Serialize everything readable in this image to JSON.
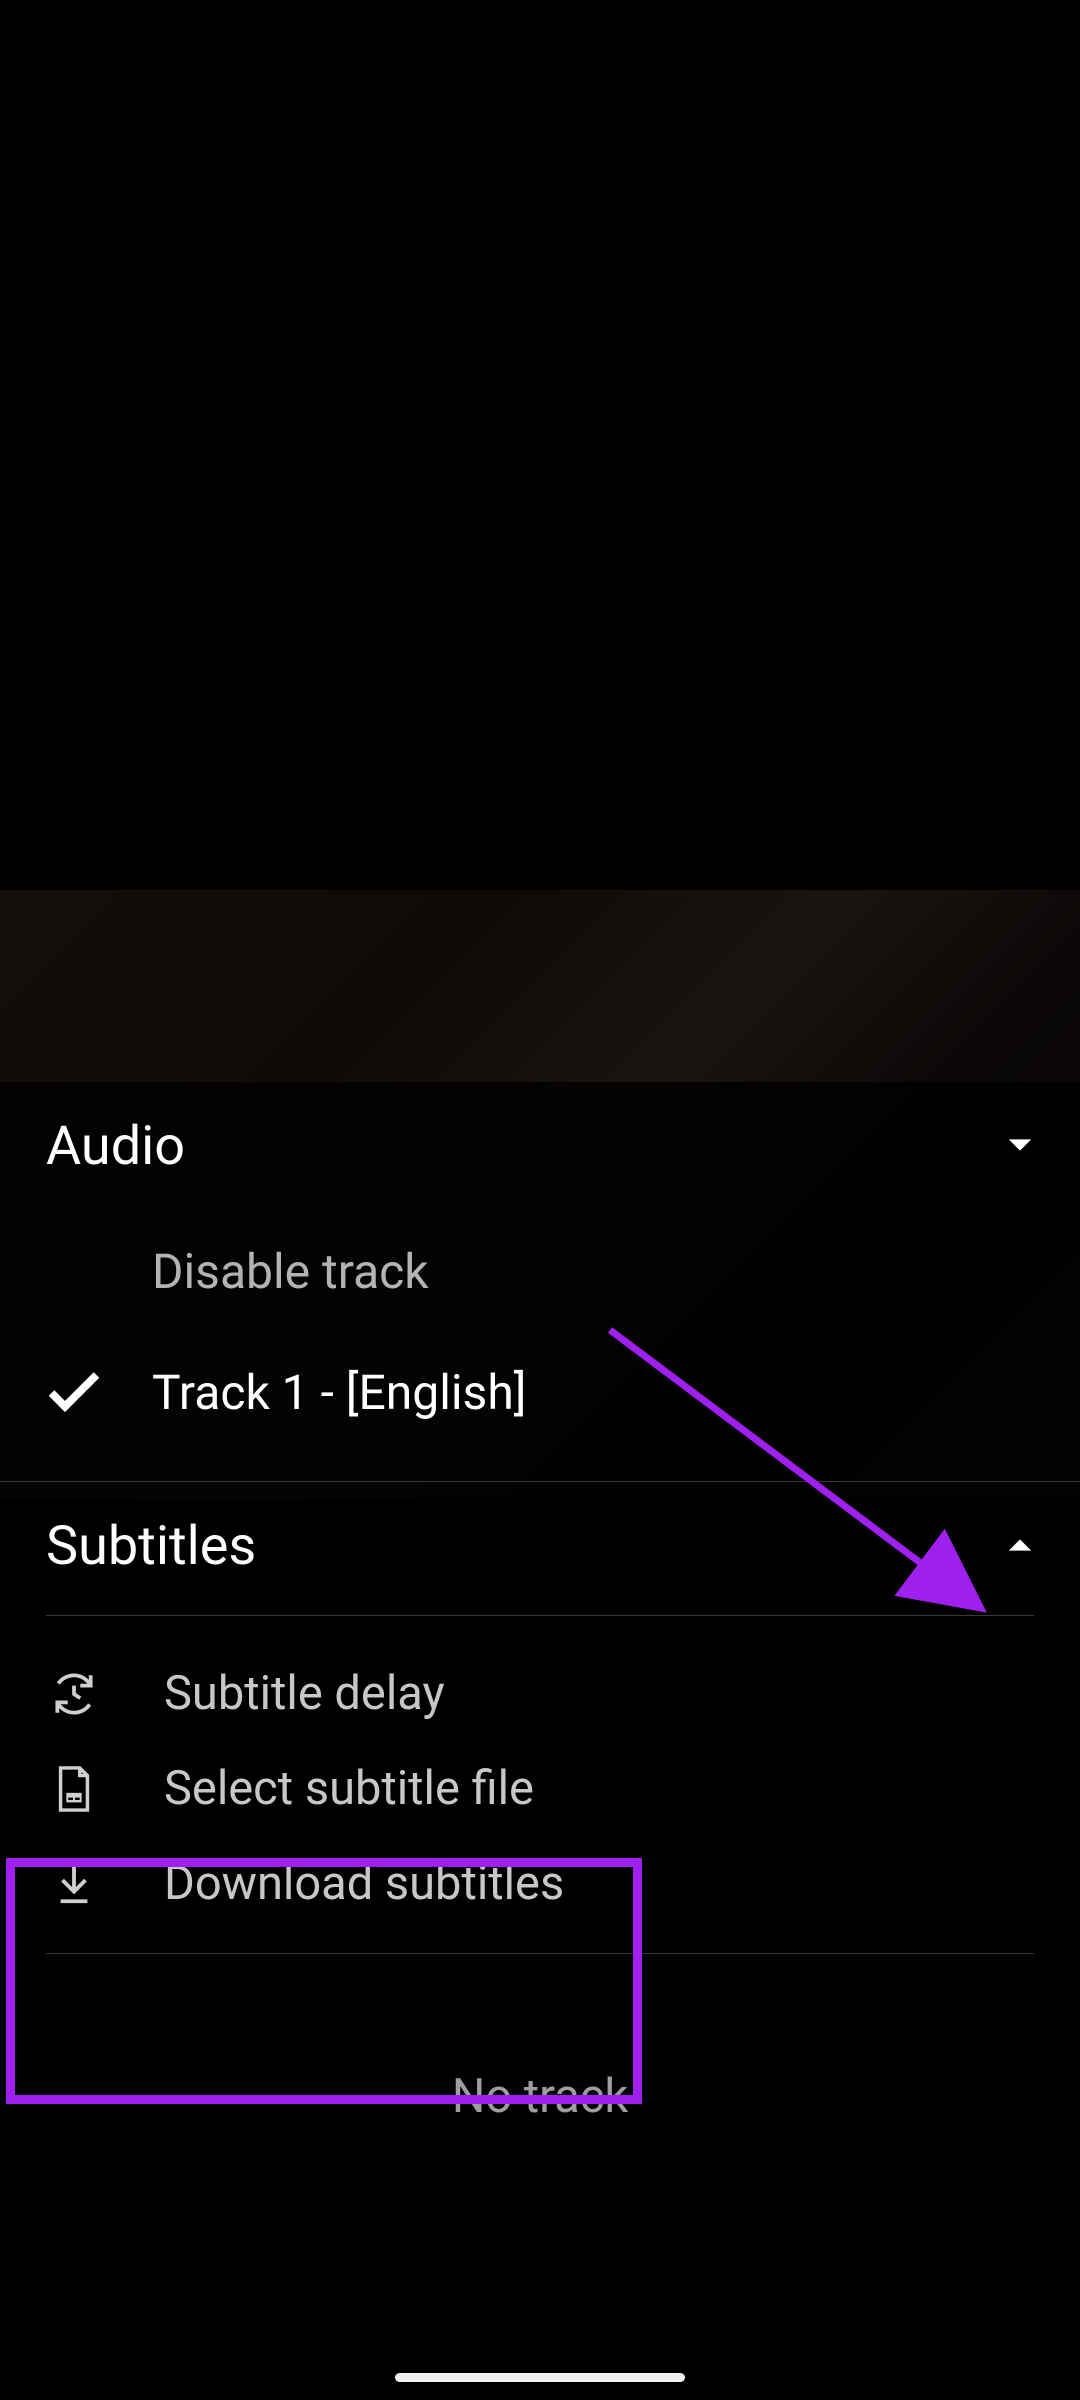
{
  "audio": {
    "title": "Audio",
    "disable_label": "Disable track",
    "tracks": [
      {
        "label": "Track 1 - [English]",
        "selected": true
      }
    ]
  },
  "subtitles": {
    "title": "Subtitles",
    "delay_label": "Subtitle delay",
    "select_file_label": "Select subtitle file",
    "download_label": "Download subtitles",
    "no_track_label": "No track"
  },
  "colors": {
    "annotation": "#a020f0"
  }
}
